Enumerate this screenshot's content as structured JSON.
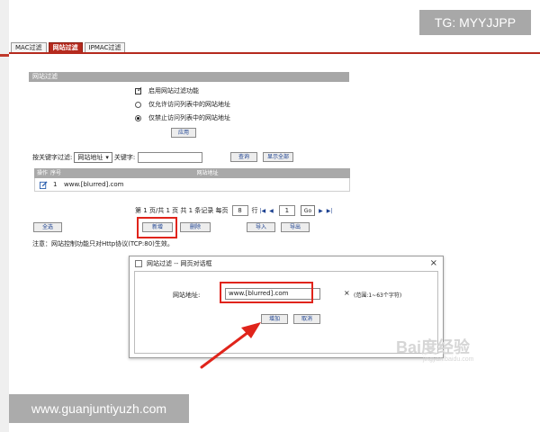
{
  "tabs": [
    {
      "label": "MAC过滤",
      "active": false
    },
    {
      "label": "网站过滤",
      "active": true
    },
    {
      "label": "IPMAC过滤",
      "active": false
    }
  ],
  "section": {
    "title": "网站过滤"
  },
  "options": {
    "enable_label": "启用网站过滤功能",
    "allow_only_label": "仅允许访问列表中的网站地址",
    "block_only_label": "仅禁止访问列表中的网站地址",
    "apply_label": "应用"
  },
  "filter": {
    "keyword_filter_label": "按关键字过滤:",
    "select_value": "网站地址",
    "keyword_label": "关键字:",
    "search_label": "查询",
    "show_all_label": "显示全部"
  },
  "table": {
    "headers": [
      "操作",
      "序号",
      "网站地址"
    ],
    "rows": [
      {
        "index": "1",
        "url": "www.[blurred].com"
      }
    ]
  },
  "pager": {
    "page_info": "第 1 页/共 1 页 共 1 条记录 每页",
    "per_page": "8",
    "rows_label": "行",
    "goto_value": "1",
    "go_label": "Go"
  },
  "actions": {
    "select_all": "全选",
    "add": "新增",
    "delete": "删除",
    "import": "导入",
    "export": "导出"
  },
  "notice": "注意：网站控制功能只对Http协议(TCP:80)生效。",
  "dialog": {
    "title": "网站过滤 -- 网页对话框",
    "url_label": "网站地址:",
    "url_value": "www.[blurred].com",
    "clear": "×",
    "hint": "(范围:1~63个字符)",
    "add_label": "增加",
    "cancel_label": "取消"
  },
  "watermarks": {
    "tg": "TG: MYYJJPP",
    "url": "www.guanjuntiyuzh.com",
    "baidu": "Bai度经验",
    "baidu_sub": "jingyan.baidu.com"
  },
  "colors": {
    "accent": "#b52a1e",
    "highlight": "#e0241b",
    "header_gray": "#a9a9a9"
  }
}
